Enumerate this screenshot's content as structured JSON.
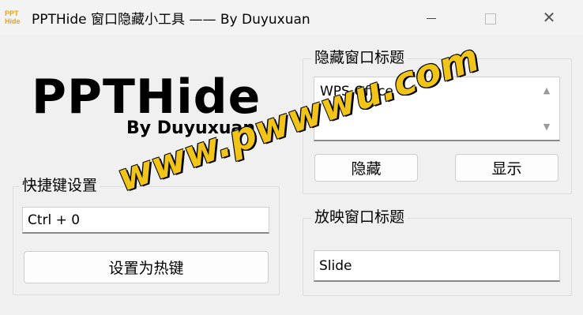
{
  "window": {
    "title": "PPTHide 窗口隐藏小工具 —— By Duyuxuan",
    "icon_text_top": "PPT",
    "icon_text_bottom": "Hide",
    "controls": [
      "minimize",
      "maximize",
      "close"
    ]
  },
  "logo": {
    "title": "PPTHide",
    "subtitle": "By Duyuxuan"
  },
  "hotkey_group": {
    "label": "快捷键设置",
    "input_value": "Ctrl + 0",
    "set_button": "设置为热键"
  },
  "hide_group": {
    "label": "隐藏窗口标题",
    "items": [
      "WPS Office"
    ],
    "hide_button": "隐藏",
    "show_button": "显示"
  },
  "show_group": {
    "label": "放映窗口标题",
    "input_value": "Slide"
  },
  "watermark": {
    "text": "www.pwwwu.com"
  },
  "colors": {
    "window_bg": "#f0f0f0",
    "watermark": "#f0c419",
    "icon": "#e8a317"
  }
}
